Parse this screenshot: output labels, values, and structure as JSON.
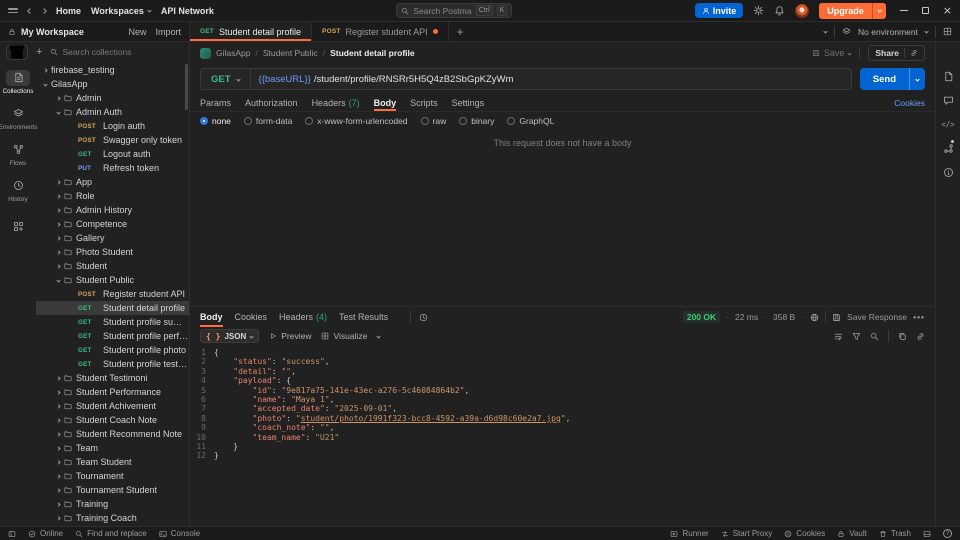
{
  "colors": {
    "accent": "#ff6c37",
    "primary_blue": "#0265d2",
    "get": "#3fba83",
    "post": "#d8a355",
    "put": "#74a2f7",
    "success": "#2ea86b"
  },
  "titlebar": {
    "nav_home": "Home",
    "nav_workspaces": "Workspaces",
    "nav_api_network": "API Network",
    "search_placeholder": "Search Postman",
    "shortcut_ctrl": "Ctrl",
    "shortcut_k": "K",
    "invite_label": "Invite",
    "upgrade_label": "Upgrade"
  },
  "workspace_bar": {
    "title": "My Workspace",
    "new_label": "New",
    "import_label": "Import",
    "environment": "No environment"
  },
  "tabs": [
    {
      "method": "GET",
      "label": "Student detail profile",
      "active": true,
      "dirty": false
    },
    {
      "method": "POST",
      "label": "Register student API",
      "active": false,
      "dirty": true
    }
  ],
  "breadcrumb": {
    "collection": "GilasApp",
    "folder": "Student Public",
    "request": "Student detail profile",
    "save_label": "Save",
    "share_label": "Share"
  },
  "sidebar": {
    "search_placeholder": "Search collections",
    "rail": [
      {
        "label": "Collections",
        "icon": "collections",
        "active": true
      },
      {
        "label": "Environments",
        "icon": "environments",
        "active": false
      },
      {
        "label": "Flows",
        "icon": "flows",
        "active": false
      },
      {
        "label": "History",
        "icon": "history",
        "active": false
      },
      {
        "label": "",
        "icon": "more",
        "active": false
      }
    ],
    "tree": [
      {
        "label": "firebase_testing",
        "level": 0,
        "kind": "collection",
        "expanded": false
      },
      {
        "label": "GilasApp",
        "level": 0,
        "kind": "collection",
        "expanded": true
      },
      {
        "label": "Admin",
        "level": 1,
        "kind": "folder",
        "expanded": false
      },
      {
        "label": "Admin Auth",
        "level": 1,
        "kind": "folder",
        "expanded": true
      },
      {
        "label": "Login auth",
        "level": 2,
        "kind": "request",
        "method": "POST"
      },
      {
        "label": "Swagger only token",
        "level": 2,
        "kind": "request",
        "method": "POST"
      },
      {
        "label": "Logout auth",
        "level": 2,
        "kind": "request",
        "method": "GET"
      },
      {
        "label": "Refresh token",
        "level": 2,
        "kind": "request",
        "method": "PUT"
      },
      {
        "label": "App",
        "level": 1,
        "kind": "folder",
        "expanded": false
      },
      {
        "label": "Role",
        "level": 1,
        "kind": "folder",
        "expanded": false
      },
      {
        "label": "Admin History",
        "level": 1,
        "kind": "folder",
        "expanded": false
      },
      {
        "label": "Competence",
        "level": 1,
        "kind": "folder",
        "expanded": false
      },
      {
        "label": "Gallery",
        "level": 1,
        "kind": "folder",
        "expanded": false
      },
      {
        "label": "Photo Student",
        "level": 1,
        "kind": "folder",
        "expanded": false
      },
      {
        "label": "Student",
        "level": 1,
        "kind": "folder",
        "expanded": false
      },
      {
        "label": "Student Public",
        "level": 1,
        "kind": "folder",
        "expanded": true
      },
      {
        "label": "Register student API",
        "level": 2,
        "kind": "request",
        "method": "POST"
      },
      {
        "label": "Student detail profile",
        "level": 2,
        "kind": "request",
        "method": "GET",
        "selected": true
      },
      {
        "label": "Student profile summary",
        "level": 2,
        "kind": "request",
        "method": "GET"
      },
      {
        "label": "Student profile performance",
        "level": 2,
        "kind": "request",
        "method": "GET"
      },
      {
        "label": "Student profile photo",
        "level": 2,
        "kind": "request",
        "method": "GET"
      },
      {
        "label": "Student profile testimoni",
        "level": 2,
        "kind": "request",
        "method": "GET"
      },
      {
        "label": "Student Testimoni",
        "level": 1,
        "kind": "folder",
        "expanded": false
      },
      {
        "label": "Student Performance",
        "level": 1,
        "kind": "folder",
        "expanded": false
      },
      {
        "label": "Student Achivement",
        "level": 1,
        "kind": "folder",
        "expanded": false
      },
      {
        "label": "Student Coach Note",
        "level": 1,
        "kind": "folder",
        "expanded": false
      },
      {
        "label": "Student Recommend Note",
        "level": 1,
        "kind": "folder",
        "expanded": false
      },
      {
        "label": "Team",
        "level": 1,
        "kind": "folder",
        "expanded": false
      },
      {
        "label": "Team Student",
        "level": 1,
        "kind": "folder",
        "expanded": false
      },
      {
        "label": "Tournament",
        "level": 1,
        "kind": "folder",
        "expanded": false
      },
      {
        "label": "Tournament Student",
        "level": 1,
        "kind": "folder",
        "expanded": false
      },
      {
        "label": "Training",
        "level": 1,
        "kind": "folder",
        "expanded": false
      },
      {
        "label": "Training Coach",
        "level": 1,
        "kind": "folder",
        "expanded": false
      }
    ]
  },
  "request": {
    "method": "GET",
    "url_variable": "{{baseURL}}",
    "url_path": "/student/profile/RNSRr5H5Q4zB2SbGpKZyWm",
    "send_label": "Send",
    "tabs": [
      {
        "label": "Params"
      },
      {
        "label": "Authorization"
      },
      {
        "label": "Headers",
        "count": "(7)"
      },
      {
        "label": "Body",
        "active": true
      },
      {
        "label": "Scripts"
      },
      {
        "label": "Settings"
      }
    ],
    "cookies_link": "Cookies",
    "body_modes": [
      "none",
      "form-data",
      "x-www-form-urlencoded",
      "raw",
      "binary",
      "GraphQL"
    ],
    "selected_mode": "none",
    "empty_message": "This request does not have a body"
  },
  "response": {
    "tabs": [
      {
        "label": "Body",
        "active": true
      },
      {
        "label": "Cookies"
      },
      {
        "label": "Headers",
        "count": "(4)"
      },
      {
        "label": "Test Results"
      }
    ],
    "status": "200 OK",
    "time": "22 ms",
    "size": "358 B",
    "save_label": "Save Response",
    "format_label": "JSON",
    "preview_label": "Preview",
    "visualize_label": "Visualize",
    "lines": [
      {
        "n": "1",
        "t": [
          [
            "p",
            "{"
          ]
        ]
      },
      {
        "n": "2",
        "t": [
          [
            "p",
            "    "
          ],
          [
            "k",
            "\"status\""
          ],
          [
            "p",
            ": "
          ],
          [
            "s",
            "\"success\""
          ],
          [
            "p",
            ","
          ]
        ]
      },
      {
        "n": "3",
        "t": [
          [
            "p",
            "    "
          ],
          [
            "k",
            "\"detail\""
          ],
          [
            "p",
            ": "
          ],
          [
            "s",
            "\"\""
          ],
          [
            "p",
            ","
          ]
        ]
      },
      {
        "n": "4",
        "t": [
          [
            "p",
            "    "
          ],
          [
            "k",
            "\"payload\""
          ],
          [
            "p",
            ": {"
          ]
        ]
      },
      {
        "n": "5",
        "t": [
          [
            "p",
            "        "
          ],
          [
            "k",
            "\"id\""
          ],
          [
            "p",
            ": "
          ],
          [
            "s",
            "\"9e817a75-141e-43ec-a276-5c46084864b2\""
          ],
          [
            "p",
            ","
          ]
        ]
      },
      {
        "n": "6",
        "t": [
          [
            "p",
            "        "
          ],
          [
            "k",
            "\"name\""
          ],
          [
            "p",
            ": "
          ],
          [
            "s",
            "\"Maya 1\""
          ],
          [
            "p",
            ","
          ]
        ]
      },
      {
        "n": "7",
        "t": [
          [
            "p",
            "        "
          ],
          [
            "k",
            "\"accepted_date\""
          ],
          [
            "p",
            ": "
          ],
          [
            "s",
            "\"2025-09-01\""
          ],
          [
            "p",
            ","
          ]
        ]
      },
      {
        "n": "8",
        "t": [
          [
            "p",
            "        "
          ],
          [
            "k",
            "\"photo\""
          ],
          [
            "p",
            ": "
          ],
          [
            "s",
            "\""
          ],
          [
            "l",
            "student/photo/1991f323-bcc8-4592-a39a-d6d98c60e2a7.jpg"
          ],
          [
            "s",
            "\""
          ],
          [
            "p",
            ","
          ]
        ]
      },
      {
        "n": "9",
        "t": [
          [
            "p",
            "        "
          ],
          [
            "k",
            "\"coach_note\""
          ],
          [
            "p",
            ": "
          ],
          [
            "s",
            "\"\""
          ],
          [
            "p",
            ","
          ]
        ]
      },
      {
        "n": "10",
        "t": [
          [
            "p",
            "        "
          ],
          [
            "k",
            "\"team_name\""
          ],
          [
            "p",
            ": "
          ],
          [
            "s",
            "\"U21\""
          ]
        ]
      },
      {
        "n": "11",
        "t": [
          [
            "p",
            "    }"
          ]
        ]
      },
      {
        "n": "12",
        "t": [
          [
            "p",
            "}"
          ]
        ]
      }
    ]
  },
  "right_rail": [
    {
      "icon": "file",
      "name": "documentation"
    },
    {
      "icon": "comment",
      "name": "comments"
    },
    {
      "icon": "code",
      "name": "code-snippet"
    },
    {
      "icon": "related",
      "name": "related-requests",
      "dot": true
    },
    {
      "icon": "info",
      "name": "info"
    }
  ],
  "statusbar": {
    "left": [
      {
        "icon": "panel",
        "name": "toggle-sidebar",
        "label": ""
      },
      {
        "icon": "check",
        "name": "online-status",
        "label": "Online"
      },
      {
        "icon": "search",
        "name": "find-and-replace",
        "label": "Find and replace"
      },
      {
        "icon": "console",
        "name": "console",
        "label": "Console"
      }
    ],
    "right": [
      {
        "icon": "runner",
        "name": "runner",
        "label": "Runner"
      },
      {
        "icon": "proxy",
        "name": "start-proxy",
        "label": "Start Proxy"
      },
      {
        "icon": "cookie",
        "name": "cookies",
        "label": "Cookies"
      },
      {
        "icon": "lock",
        "name": "vault",
        "label": "Vault"
      },
      {
        "icon": "trash",
        "name": "trash",
        "label": "Trash"
      },
      {
        "icon": "panel-bottom",
        "name": "toggle-bottom-panel",
        "label": ""
      },
      {
        "icon": "help",
        "name": "help",
        "label": ""
      }
    ]
  }
}
